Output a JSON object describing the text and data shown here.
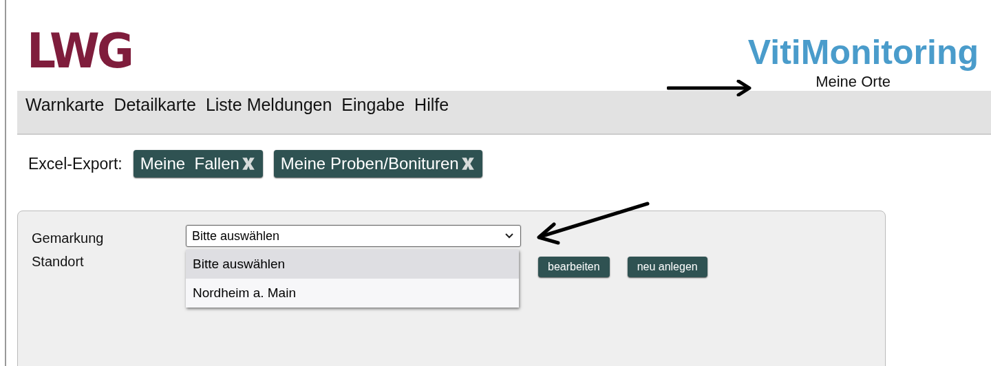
{
  "logo": {
    "text": "LWG"
  },
  "app_title": "VitiMonitoring",
  "subtitle": "Meine Orte",
  "nav": [
    {
      "label": "Warnkarte"
    },
    {
      "label": "Detailkarte"
    },
    {
      "label": "Liste Meldungen"
    },
    {
      "label": "Eingabe"
    },
    {
      "label": "Hilfe"
    }
  ],
  "export": {
    "label": "Excel-Export:",
    "buttons": [
      {
        "label": "Meine  Fallen"
      },
      {
        "label": "Meine Proben/Bonituren"
      }
    ]
  },
  "form": {
    "fields": [
      {
        "label": "Gemarkung",
        "kind": "select",
        "value": "Bitte auswählen",
        "expanded": true,
        "options": [
          {
            "label": "Bitte auswählen",
            "selected": true
          },
          {
            "label": "Nordheim a. Main",
            "selected": false
          }
        ]
      },
      {
        "label": "Standort",
        "kind": "actions",
        "buttons": [
          {
            "label": "bearbeiten"
          },
          {
            "label": "neu anlegen"
          }
        ]
      }
    ]
  }
}
